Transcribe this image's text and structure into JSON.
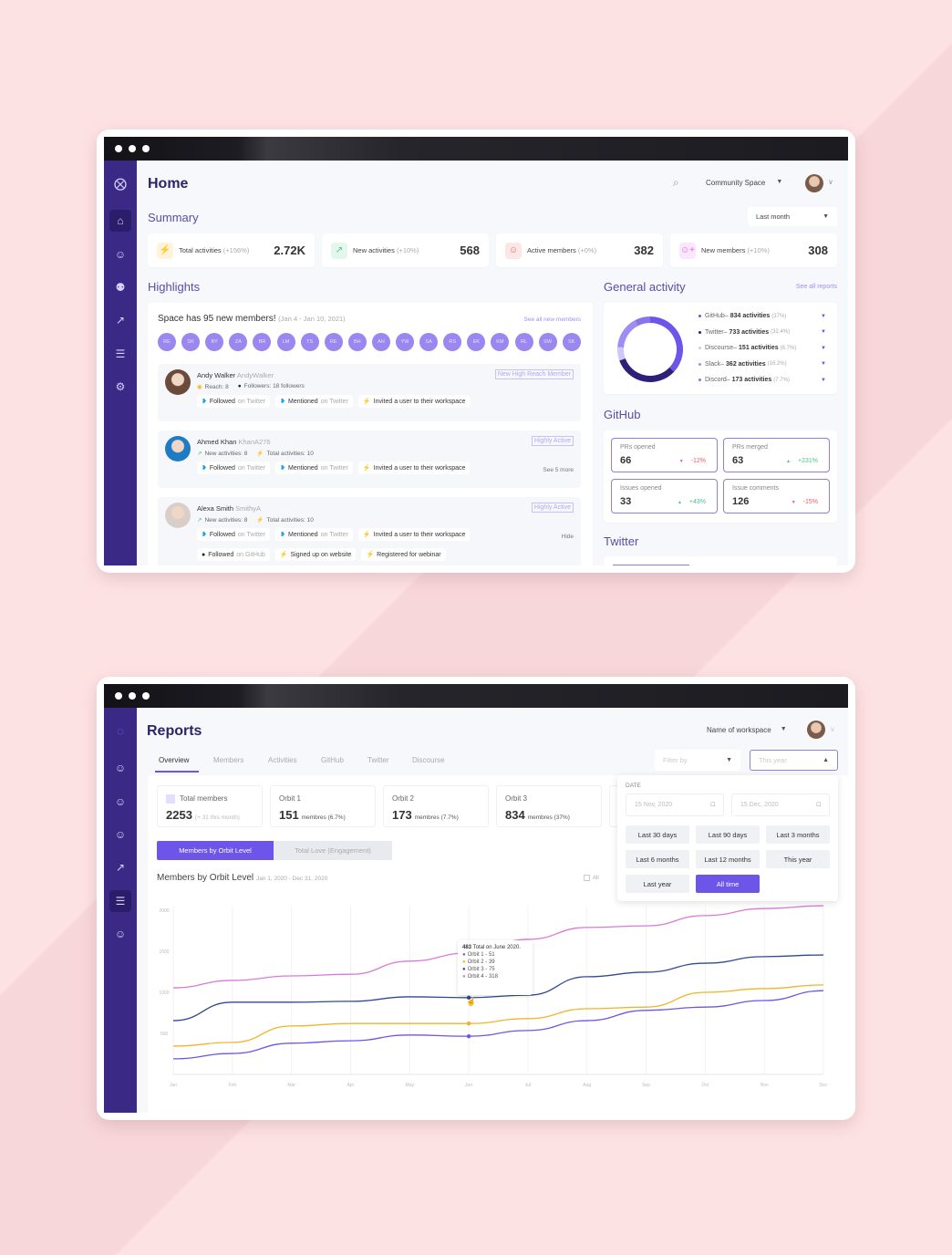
{
  "colors": {
    "sidebar": "#3a2a86",
    "accent": "#6c55e8",
    "heading": "#2d2466",
    "background": "#fde2e4"
  },
  "home": {
    "title": "Home",
    "search_icon": "search-icon",
    "workspace": "Community Space",
    "summary": {
      "title": "Summary",
      "period": "Last month",
      "stats": [
        {
          "label": "Total activities",
          "change": "(+156%)",
          "value": "2.72K",
          "icon": "lightning-icon",
          "color": "#f5b52e",
          "bg": "#fff3dc"
        },
        {
          "label": "New activities",
          "change": "(+10%)",
          "value": "568",
          "icon": "trend-icon",
          "color": "#4cc38a",
          "bg": "#e3f7ec"
        },
        {
          "label": "Active members",
          "change": "(+0%)",
          "value": "382",
          "icon": "user-icon",
          "color": "#ef6b6b",
          "bg": "#fde6e6"
        },
        {
          "label": "New members",
          "change": "(+10%)",
          "value": "308",
          "icon": "user-plus-icon",
          "color": "#d46ee0",
          "bg": "#fbe6fb"
        }
      ]
    },
    "highlights": {
      "title": "Highlights",
      "headline": "Space has 95 new members!",
      "range": "(Jan 4 - Jan 10, 2021)",
      "see_all": "See all new members",
      "initials": [
        "RE",
        "SK",
        "BY",
        "ZA",
        "BR",
        "LM",
        "TS",
        "RE",
        "BH",
        "AH",
        "YW",
        "SA",
        "RS",
        "EK",
        "KM",
        "RL",
        "SW",
        "SK"
      ],
      "members": [
        {
          "name": "Andy Walker",
          "handle": "AndyWalker",
          "badge": "New High Reach Member",
          "avatar": "#6b4a3a",
          "meta": [
            {
              "icon": "reach-icon",
              "text": "Reach: 8"
            },
            {
              "icon": "github-icon",
              "text": "Followers: 18 followers"
            }
          ],
          "rows": [
            [
              {
                "icon": "twitter-icon",
                "verb": "Followed",
                "suffix": "on Twitter"
              },
              {
                "icon": "twitter-icon",
                "verb": "Mentioned",
                "suffix": "on Twitter"
              },
              {
                "icon": "lightning-icon",
                "verb": "Invited a user to their workspace",
                "suffix": ""
              }
            ]
          ],
          "more": ""
        },
        {
          "name": "Ahmed Khan",
          "handle": "KhanA276",
          "badge": "Highly Active",
          "avatar": "#1f7bc4",
          "meta": [
            {
              "icon": "trend-icon",
              "text": "New activities: 8"
            },
            {
              "icon": "lightning-icon",
              "text": "Total activities:  10"
            }
          ],
          "rows": [
            [
              {
                "icon": "twitter-icon",
                "verb": "Followed",
                "suffix": "on Twitter"
              },
              {
                "icon": "twitter-icon",
                "verb": "Mentioned",
                "suffix": "on Twitter"
              },
              {
                "icon": "lightning-icon",
                "verb": "Invited a user to their workspace",
                "suffix": ""
              }
            ]
          ],
          "more": "See 5 more"
        },
        {
          "name": "Alexa Smith",
          "handle": "SmithyA",
          "badge": "Highly Active",
          "avatar": "#d9cfc8",
          "meta": [
            {
              "icon": "trend-icon",
              "text": "New activities: 8"
            },
            {
              "icon": "lightning-icon",
              "text": "Total activities:  10"
            }
          ],
          "rows": [
            [
              {
                "icon": "twitter-icon",
                "verb": "Followed",
                "suffix": "on Twitter"
              },
              {
                "icon": "twitter-icon",
                "verb": "Mentioned",
                "suffix": "on Twitter"
              },
              {
                "icon": "lightning-icon",
                "verb": "Invited a user to their workspace",
                "suffix": ""
              }
            ],
            [
              {
                "icon": "github-icon",
                "verb": "Followed",
                "suffix": "on GitHub"
              },
              {
                "icon": "lightning-icon",
                "verb": "Signed up on website",
                "suffix": ""
              },
              {
                "icon": "lightning-icon",
                "verb": "Registered for webinar",
                "suffix": ""
              }
            ]
          ],
          "more": "Hide"
        }
      ]
    },
    "general": {
      "title": "General activity",
      "see_all": "See all reports",
      "sources": [
        {
          "name": "GitHub",
          "activities": "834 activities",
          "pct": "(37%)",
          "value": 37,
          "color": "#6c55e8"
        },
        {
          "name": "Twitter",
          "activities": "733 activities",
          "pct": "(32.4%)",
          "value": 32.4,
          "color": "#2e1f78"
        },
        {
          "name": "Discourse",
          "activities": "151 activities",
          "pct": "(6.7%)",
          "value": 6.7,
          "color": "#cfc6fa"
        },
        {
          "name": "Slack",
          "activities": "362 activities",
          "pct": "(16.2%)",
          "value": 16.2,
          "color": "#9f8cf5"
        },
        {
          "name": "Discord",
          "activities": "173 activities",
          "pct": "(7.7%)",
          "value": 7.7,
          "color": "#8a74ee"
        }
      ]
    },
    "github": {
      "title": "GitHub",
      "tiles": [
        {
          "label": "PRs opened",
          "value": "66",
          "delta": "-12%",
          "dir": "down"
        },
        {
          "label": "PRs merged",
          "value": "63",
          "delta": "+231%",
          "dir": "up"
        },
        {
          "label": "Issues opened",
          "value": "33",
          "delta": "+43%",
          "dir": "up"
        },
        {
          "label": "Issue comments",
          "value": "126",
          "delta": "-15%",
          "dir": "down"
        }
      ]
    },
    "twitter": {
      "title": "Twitter"
    }
  },
  "reports": {
    "title": "Reports",
    "workspace": "Name of workspace",
    "tabs": [
      "Overview",
      "Members",
      "Activities",
      "GitHub",
      "Twitter",
      "Discourse"
    ],
    "active_tab": "Overview",
    "filter_placeholder": "Filter by",
    "period_placeholder": "This year",
    "tiles": [
      {
        "label": "Total members",
        "value": "2253",
        "sub": "(+ 31 this month)"
      },
      {
        "label": "Orbit 1",
        "value": "151",
        "sub": "membres (6.7%)"
      },
      {
        "label": "Orbit 2",
        "value": "173",
        "sub": "membres (7.7%)"
      },
      {
        "label": "Orbit 3",
        "value": "834",
        "sub": "membres (37%)"
      }
    ],
    "toggle": [
      "Members by Orbit Level",
      "Total Love (Engagement)"
    ],
    "chart_title": "Members by Orbit Level",
    "chart_range": "Jan 1, 2020 - Dec 31, 2020",
    "all_label": "All",
    "date_panel": {
      "label": "DATE",
      "from": "15 Nov, 2020",
      "to": "15 Dec, 2020",
      "options": [
        "Last 30 days",
        "Last 90 days",
        "Last 3 months",
        "Last 6 months",
        "Last 12 months",
        "This year",
        "Last year",
        "All time"
      ],
      "selected": "All time"
    },
    "tooltip": {
      "total": "483",
      "text": "Total on June 2020.",
      "items": [
        "Orbit 1 - 51",
        "Orbit 2 - 39",
        "Orbit 3 - 75",
        "Orbit 4 - 318"
      ]
    }
  },
  "chart_data": {
    "type": "line",
    "title": "Members by Orbit Level",
    "categories": [
      "Jan",
      "Feb",
      "Mar",
      "Apr",
      "May",
      "Jun",
      "Jul",
      "Aug",
      "Sep",
      "Oct",
      "Nov",
      "Dec"
    ],
    "ylim": [
      0,
      2000
    ],
    "yticks": [
      500,
      1000,
      1500,
      2000
    ],
    "grid": true,
    "series": [
      {
        "name": "Orbit 1",
        "color": "#6f55e6",
        "values": [
          190,
          255,
          380,
          410,
          480,
          465,
          535,
          655,
          780,
          820,
          900,
          1020
        ]
      },
      {
        "name": "Orbit 2",
        "color": "#f0b429",
        "values": [
          345,
          390,
          590,
          620,
          620,
          620,
          680,
          800,
          820,
          1000,
          1045,
          1090
        ]
      },
      {
        "name": "Orbit 3",
        "color": "#2f4a8f",
        "values": [
          655,
          880,
          880,
          890,
          945,
          935,
          965,
          1190,
          1245,
          1355,
          1435,
          1455
        ]
      },
      {
        "name": "Orbit 4",
        "color": "#d97ad9",
        "values": [
          1055,
          1145,
          1200,
          1220,
          1380,
          1480,
          1645,
          1790,
          1810,
          1935,
          2020,
          2055
        ]
      }
    ],
    "highlight_category": "Jun"
  }
}
